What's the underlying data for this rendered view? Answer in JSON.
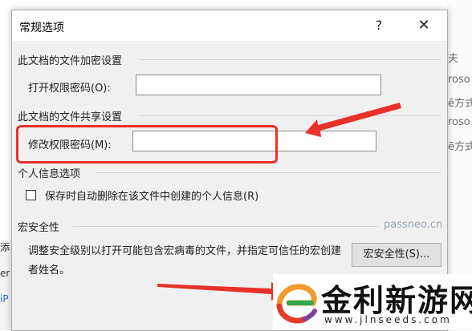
{
  "background": {
    "right_fragments": [
      "夫",
      "roso",
      "ē方式",
      "roso",
      "ē方式"
    ],
    "left_fragments": [
      "添",
      "er",
      "iP"
    ]
  },
  "dialog": {
    "title": "常规选项",
    "help_label": "?",
    "close_label": "✕",
    "encryption": {
      "section_title": "此文档的文件加密设置",
      "open_password_label": "打开权限密码(O):",
      "open_password_value": ""
    },
    "sharing": {
      "section_title": "此文档的文件共享设置",
      "modify_password_label": "修改权限密码(M):",
      "modify_password_value": ""
    },
    "privacy": {
      "section_title": "个人信息选项",
      "remove_info_label": "保存时自动删除在该文件中创建的个人信息(R)",
      "remove_info_checked": false
    },
    "macro": {
      "section_title": "宏安全性",
      "description": "调整安全级别以打开可能包含宏病毒的文件，并指定可信任的宏创建者姓名。",
      "button_label": "宏安全性(S)..."
    }
  },
  "watermark": "passneo.cn",
  "logo": {
    "name": "金利新游网",
    "url": "www.jlnseeds.com"
  },
  "colors": {
    "annotation_red": "#e8312a",
    "dialog_bg": "#f0f0f0",
    "logo_orange": "#f29a2e",
    "logo_green": "#2fa84f",
    "logo_red": "#e23a2c",
    "logo_purple": "#7b3fa0"
  }
}
